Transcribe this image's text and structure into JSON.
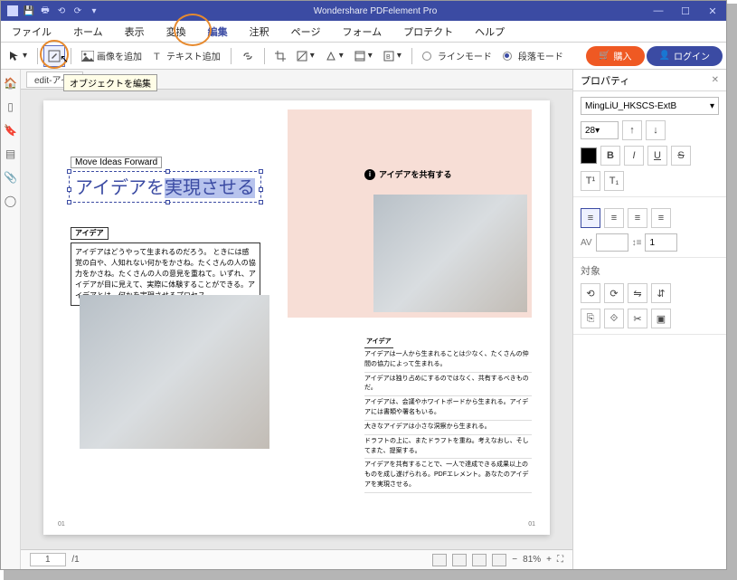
{
  "app": {
    "title": "Wondershare PDFelement Pro"
  },
  "menu": [
    "ファイル",
    "ホーム",
    "表示",
    "変換",
    "編集",
    "注釈",
    "ページ",
    "フォーム",
    "プロテクト",
    "ヘルプ"
  ],
  "menu_active": 4,
  "toolbar": {
    "add_image": "画像を追加",
    "add_text": "テキスト追加",
    "line_mode": "ラインモード",
    "para_mode": "段落モード",
    "buy": "購入",
    "login": "ログイン"
  },
  "tab": {
    "name_visible": "edit-アイ"
  },
  "tooltip": "オブジェクトを編集",
  "document": {
    "headline_en": "Move Ideas Forward",
    "headline_jp_pre": "アイデアを",
    "headline_jp_hl": "実現させる",
    "share_label": "アイデアを共有する",
    "idea1": {
      "hdr": "アイデア",
      "body": "アイデアはどうやって生まれるのだろう。\nときには感覚の白や、人知れない何かをかさね。たくさんの人の協力をかさね。たくさんの人の意見を重ねて。いずれ、アイデアが目に見えて、実際に体験することができる。アイデアとは、何かを実現させるプロセス。"
    },
    "idea2": {
      "hdr": "アイデア",
      "p1": "アイデアは一人から生まれることは少なく、たくさんの仲間の協力によって生まれる。",
      "p2": "アイデアは独り占めにするのではなく、共有するべきものだ。",
      "p3": "アイデアは、会議やホワイトボードから生まれる。アイデアには書類や署名もいる。",
      "p4": "大きなアイデアは小さな洞察から生まれる。",
      "p5": "ドラフトの上に、またドラフトを重ね。考えなおし、そしてまた、提案する。",
      "p6": "アイデアを共有することで、一人で達成できる成果以上のものを成し遂げられる。PDFエレメント。あなたのアイデアを実現させる。"
    }
  },
  "props": {
    "title": "プロパティ",
    "font": "MingLiU_HKSCS-ExtB",
    "size": "28",
    "transform_title": "対象",
    "spacing_value": "1"
  },
  "status": {
    "page_current": "1",
    "page_sep": "/1",
    "zoom": "81%"
  }
}
